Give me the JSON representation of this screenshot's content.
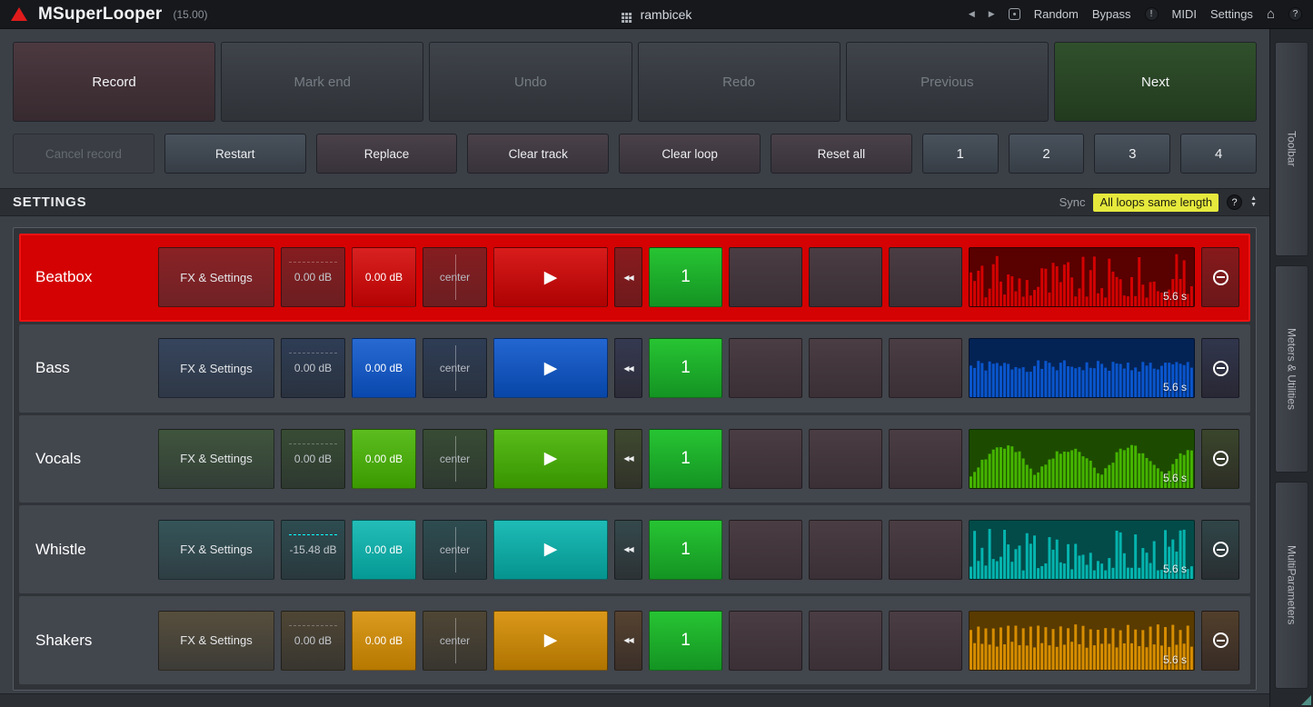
{
  "titlebar": {
    "app_name": "MSuperLooper",
    "version": "(15.00)",
    "preset_name": "rambicek",
    "random_label": "Random",
    "bypass_label": "Bypass",
    "midi_label": "MIDI",
    "settings_label": "Settings",
    "alert_glyph": "!",
    "home_glyph": "⌂",
    "help_glyph": "?",
    "prev_glyph": "◀",
    "next_glyph": "▶"
  },
  "toolbar": {
    "record": "Record",
    "mark_end": "Mark end",
    "undo": "Undo",
    "redo": "Redo",
    "previous": "Previous",
    "next": "Next",
    "cancel_record": "Cancel record",
    "restart": "Restart",
    "replace": "Replace",
    "clear_track": "Clear track",
    "clear_loop": "Clear loop",
    "reset_all": "Reset all",
    "loop_buttons": [
      "1",
      "2",
      "3",
      "4"
    ]
  },
  "settings_bar": {
    "title": "SETTINGS",
    "sync_label": "Sync",
    "sync_value": "All loops same length",
    "help_glyph": "?"
  },
  "tracks": [
    {
      "name": "Beatbox",
      "fx_label": "FX & Settings",
      "gain1": "0.00 dB",
      "gain2": "0.00 dB",
      "pan": "center",
      "loop_number": "1",
      "length": "5.6 s",
      "color": "#d40202",
      "active": true
    },
    {
      "name": "Bass",
      "fx_label": "FX & Settings",
      "gain1": "0.00 dB",
      "gain2": "0.00 dB",
      "pan": "center",
      "loop_number": "1",
      "length": "5.6 s",
      "color": "#0a55cc",
      "active": false
    },
    {
      "name": "Vocals",
      "fx_label": "FX & Settings",
      "gain1": "0.00 dB",
      "gain2": "0.00 dB",
      "pan": "center",
      "loop_number": "1",
      "length": "5.6 s",
      "color": "#45b400",
      "active": false
    },
    {
      "name": "Whistle",
      "fx_label": "FX & Settings",
      "gain1": "-15.48 dB",
      "gain2": "0.00 dB",
      "pan": "center",
      "loop_number": "1",
      "length": "5.6 s",
      "color": "#06b4ae",
      "active": false
    },
    {
      "name": "Shakers",
      "fx_label": "FX & Settings",
      "gain1": "0.00 dB",
      "gain2": "0.00 dB",
      "pan": "center",
      "loop_number": "1",
      "length": "5.6 s",
      "color": "#d68d00",
      "active": false
    }
  ],
  "sidebar_panels": [
    "Toolbar",
    "Meters & Utilities",
    "MultiParameters"
  ],
  "colors": {
    "loop_active_green": "#1fae2e",
    "sync_highlight": "#e6e93c",
    "active_row_border": "#f01212"
  }
}
